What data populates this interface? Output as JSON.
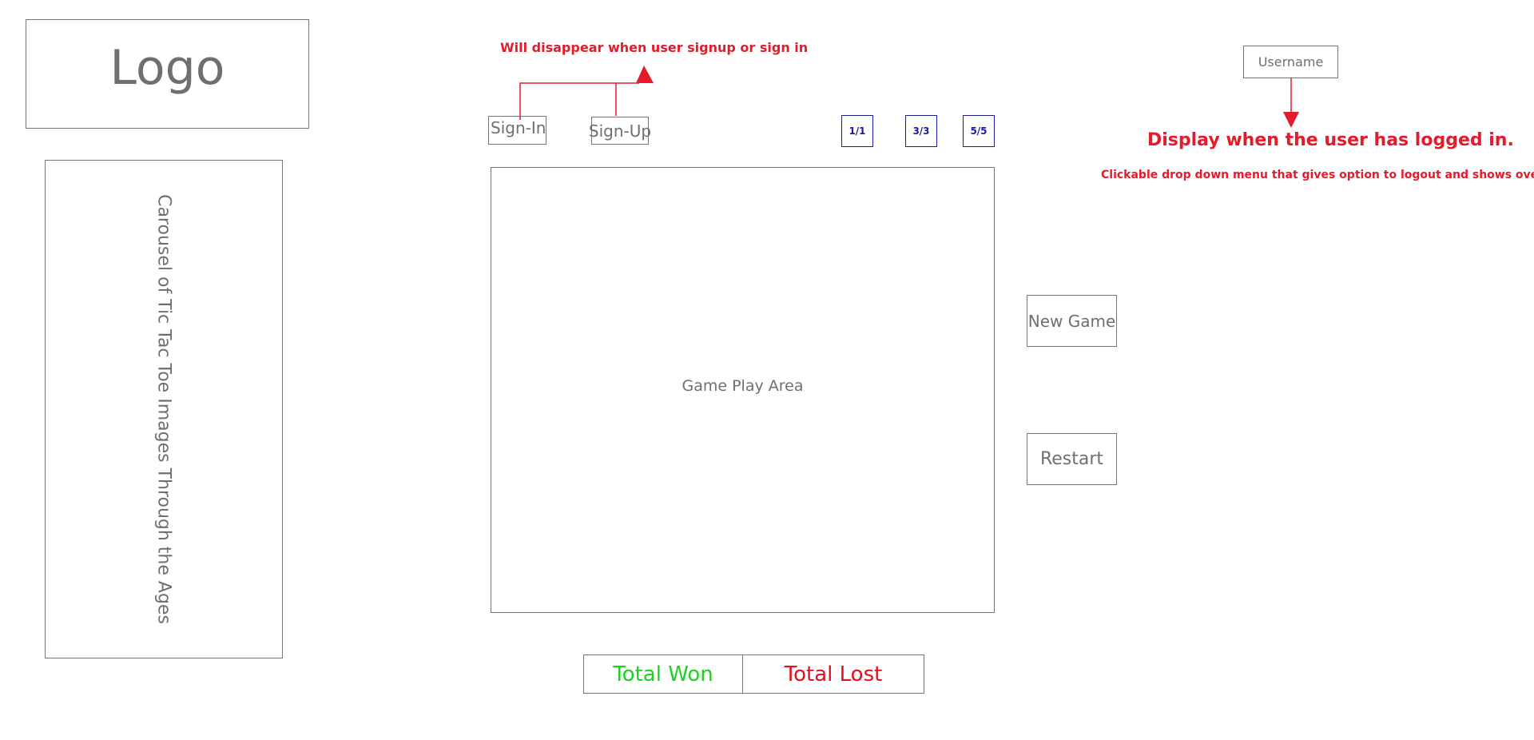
{
  "header": {
    "logo_text": "Logo"
  },
  "auth": {
    "signin_label": "Sign-In",
    "signup_label": "Sign-Up",
    "note": "Will disappear when user signup or sign in"
  },
  "levels": [
    "1/1",
    "3/3",
    "5/5"
  ],
  "user_menu": {
    "username_label": "Username",
    "note_title": "Display when the user has logged in.",
    "note_detail": "Clickable drop down menu that gives option to logout and shows oversall score"
  },
  "carousel": {
    "label": "Carousel of Tic Tac Toe Images Through the Ages"
  },
  "game": {
    "area_label": "Game Play Area",
    "new_game_label": "New Game",
    "restart_label": "Restart"
  },
  "score": {
    "won_label": "Total Won",
    "lost_label": "Total Lost"
  },
  "colors": {
    "annotation": "#e31b2b",
    "won": "#1ed11e",
    "lost": "#e0101e",
    "level_border": "#1a1a9a",
    "box_border": "#757575"
  }
}
